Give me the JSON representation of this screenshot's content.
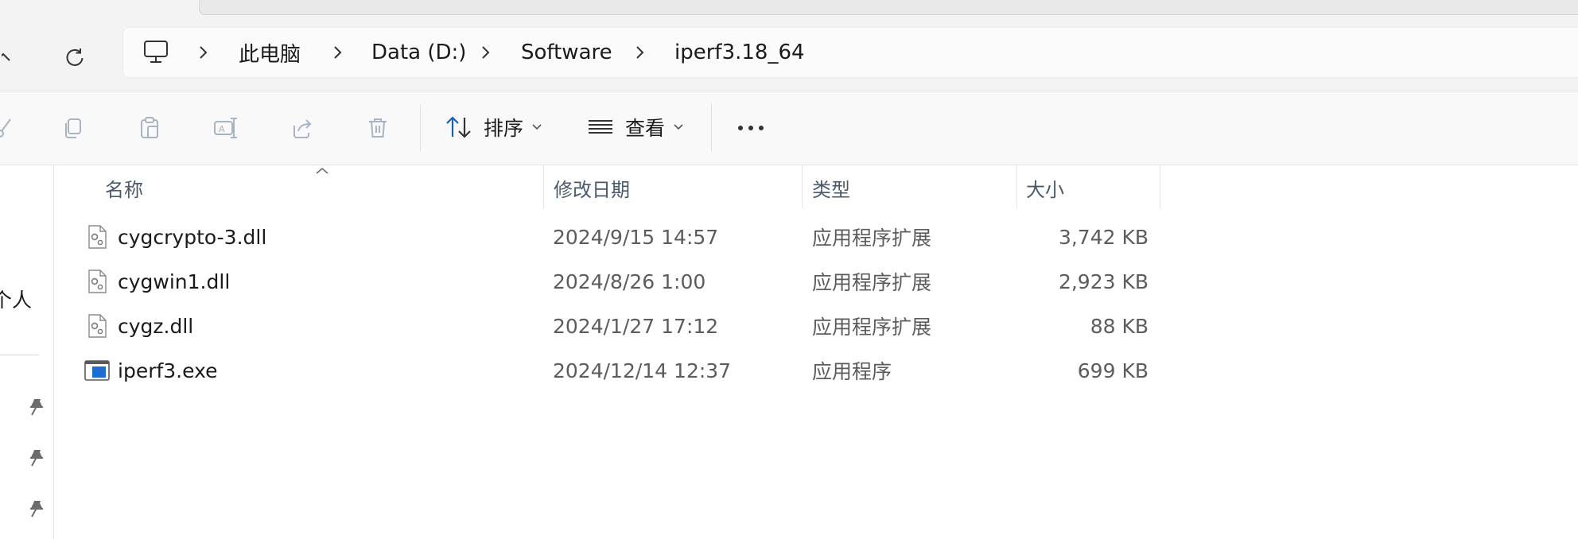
{
  "breadcrumb": {
    "items": [
      {
        "label": "此电脑"
      },
      {
        "label": "Data (D:)"
      },
      {
        "label": "Software"
      },
      {
        "label": "iperf3.18_64"
      }
    ]
  },
  "toolbar": {
    "icons": [
      "cut-icon",
      "copy-icon",
      "paste-icon",
      "rename-icon",
      "share-icon",
      "delete-icon"
    ],
    "sort_label": "排序",
    "view_label": "查看",
    "more_icon": "more-icon"
  },
  "sidebar": {
    "partial_label": "个人",
    "pins": [
      "pin-icon",
      "pin-icon",
      "pin-icon"
    ]
  },
  "columns": {
    "name": "名称",
    "date": "修改日期",
    "type": "类型",
    "size": "大小"
  },
  "files": [
    {
      "name": "cygcrypto-3.dll",
      "date": "2024/9/15 14:57",
      "type": "应用程序扩展",
      "size": "3,742 KB",
      "icon": "dll-file-icon"
    },
    {
      "name": "cygwin1.dll",
      "date": "2024/8/26 1:00",
      "type": "应用程序扩展",
      "size": "2,923 KB",
      "icon": "dll-file-icon"
    },
    {
      "name": "cygz.dll",
      "date": "2024/1/27 17:12",
      "type": "应用程序扩展",
      "size": "88 KB",
      "icon": "dll-file-icon"
    },
    {
      "name": "iperf3.exe",
      "date": "2024/12/14 12:37",
      "type": "应用程序",
      "size": "699 KB",
      "icon": "exe-file-icon"
    }
  ],
  "colors": {
    "window_bg": "#f3f3f3",
    "command_bar_bg": "#f9f9f9",
    "address_bar_bg": "#fbfbfb",
    "accent_blue": "#1a5fb4",
    "disabled_icon": "#a8b4c2"
  }
}
